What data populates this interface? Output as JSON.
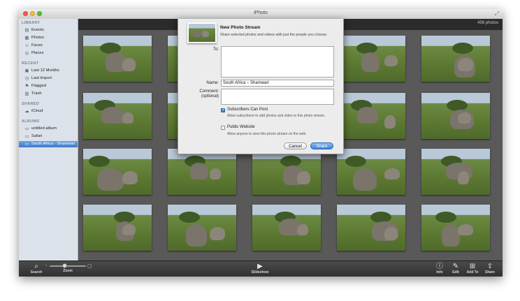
{
  "window": {
    "title": "iPhoto"
  },
  "sidebar": {
    "sections": [
      {
        "title": "LIBRARY",
        "items": [
          {
            "label": "Events",
            "icon": "events-icon"
          },
          {
            "label": "Photos",
            "icon": "photos-icon"
          },
          {
            "label": "Faces",
            "icon": "faces-icon"
          },
          {
            "label": "Places",
            "icon": "places-icon"
          }
        ]
      },
      {
        "title": "RECENT",
        "items": [
          {
            "label": "Last 12 Months",
            "icon": "calendar-icon"
          },
          {
            "label": "Last Import",
            "icon": "clock-icon"
          },
          {
            "label": "Flagged",
            "icon": "flag-icon"
          },
          {
            "label": "Trash",
            "icon": "trash-icon"
          }
        ]
      },
      {
        "title": "SHARED",
        "items": [
          {
            "label": "iCloud",
            "icon": "icloud-icon"
          }
        ]
      },
      {
        "title": "ALBUMS",
        "items": [
          {
            "label": "untitled album",
            "icon": "album-icon"
          },
          {
            "label": "Safari",
            "icon": "album-icon"
          },
          {
            "label": "South Africa - Shamwari",
            "icon": "album-icon",
            "selected": true
          }
        ]
      }
    ]
  },
  "header": {
    "photo_count": "456 photos"
  },
  "dialog": {
    "title": "New Photo Stream",
    "subtitle": "Share selected photos and videos with just the people you choose.",
    "to_label": "To:",
    "to_value": "",
    "name_label": "Name:",
    "name_value": "South Africa – Shamwari",
    "comment_label": "Comment:",
    "comment_optional": "(optional)",
    "comment_value": "",
    "subscribers_label": "Subscribers Can Post",
    "subscribers_desc": "Allow subscribers to add photos and video to this photo stream.",
    "subscribers_checked": true,
    "public_label": "Public Website",
    "public_desc": "Allow anyone to view this photo stream on the web.",
    "public_checked": false,
    "cancel_label": "Cancel",
    "share_label": "Share"
  },
  "bottom_toolbar": {
    "search_label": "Search",
    "zoom_label": "Zoom",
    "slideshow_label": "Slideshow",
    "info_label": "Info",
    "edit_label": "Edit",
    "add_to_label": "Add To",
    "share_label": "Share",
    "zoom_level": 0.4
  },
  "colors": {
    "selection": "#3f79cc",
    "share_button": "#3f82d8",
    "grid_bg": "#595959"
  }
}
